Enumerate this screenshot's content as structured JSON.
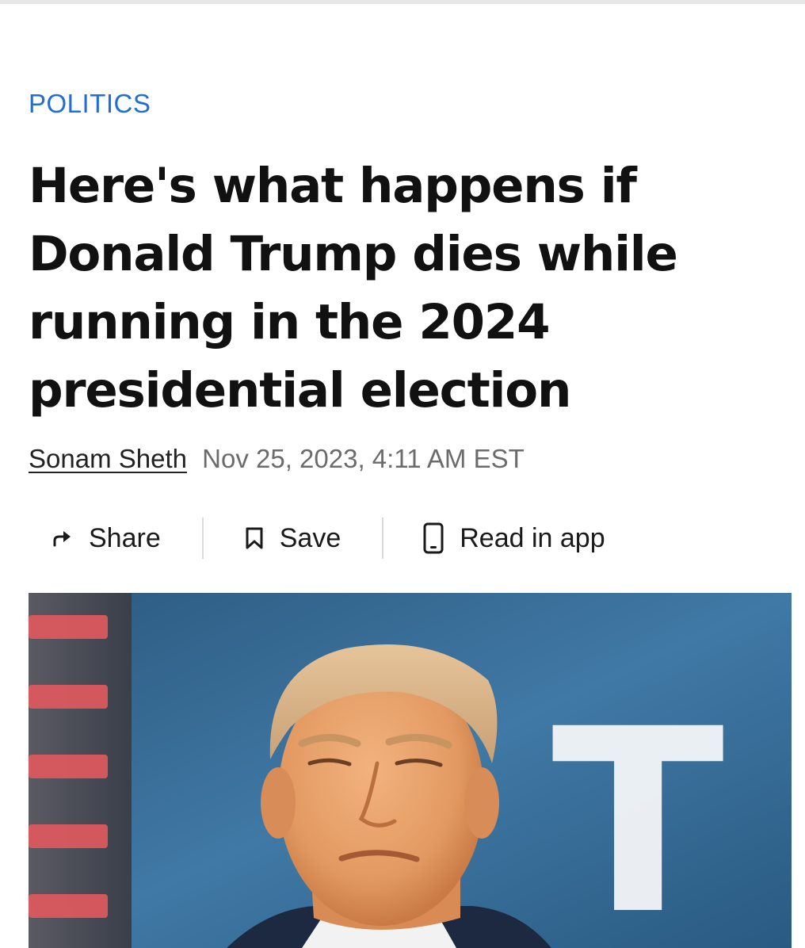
{
  "article": {
    "category": "POLITICS",
    "headline": "Here's what happens if Donald Trump dies while running in the 2024 presidential election",
    "author": "Sonam Sheth",
    "timestamp": "Nov 25, 2023, 4:11 AM EST"
  },
  "actions": {
    "share": {
      "label": "Share",
      "icon": "share-arrow-icon"
    },
    "save": {
      "label": "Save",
      "icon": "bookmark-icon"
    },
    "read_in_app": {
      "label": "Read in app",
      "icon": "phone-icon"
    }
  },
  "hero_image": {
    "subject": "portrait photo",
    "backdrop_letter": "T"
  },
  "colors": {
    "category": "#1f6fd6",
    "headline": "#111111",
    "timestamp": "#6b6b6b",
    "divider": "#d9d9d9",
    "photo_background": "#3a72a0"
  }
}
